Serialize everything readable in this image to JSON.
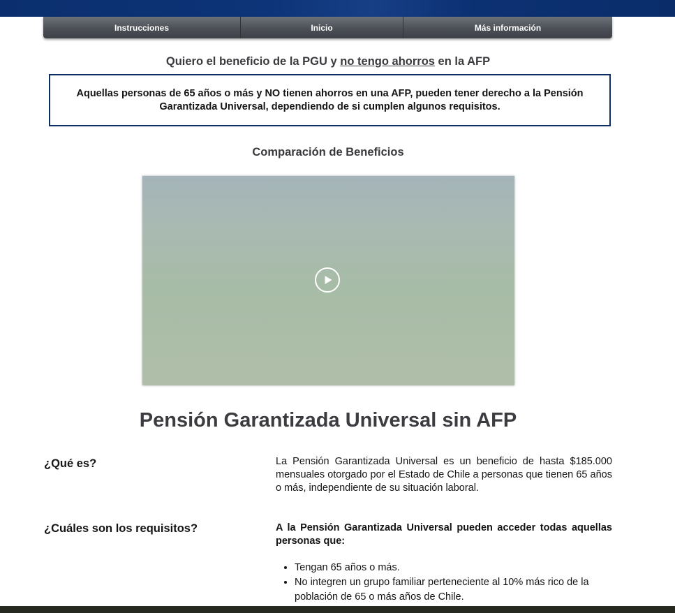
{
  "nav": {
    "items": [
      "Instrucciones",
      "Inicio",
      "Más información"
    ]
  },
  "intro": {
    "heading_prefix": "Quiero el beneficio de la PGU y",
    "heading_underlined": "no tengo ahorros",
    "heading_suffix": "en la AFP",
    "notice": "Aquellas personas de 65 años o más y NO tienen ahorros en una AFP, pueden tener derecho a la Pensión Garantizada Universal, dependiendo de si cumplen algunos requisitos."
  },
  "comparison": {
    "heading": "Comparación de Beneficios"
  },
  "video": {
    "play_icon": "play-icon"
  },
  "main": {
    "title": "Pensión Garantizada Universal sin AFP",
    "q1_label": "¿Qué es?",
    "q1_text": "La Pensión Garantizada Universal es un beneficio de hasta $185.000 mensuales otorgado por el Estado de Chile a personas que tienen 65 años o más, independiente de su situación laboral.",
    "q2_label": "¿Cuáles son los requisitos?",
    "q2_text": "A la Pensión Garantizada Universal pueden acceder todas aquellas personas que:",
    "requirements": [
      "Tengan 65 años o más.",
      "No integren un grupo familiar perteneciente al 10% más rico de la población de 65 o más años de Chile."
    ]
  },
  "colors": {
    "header_band": "#0c3173",
    "navbar": "#4b4f56",
    "box_border": "#0e2f64",
    "heading_text": "#3a3a3e"
  }
}
